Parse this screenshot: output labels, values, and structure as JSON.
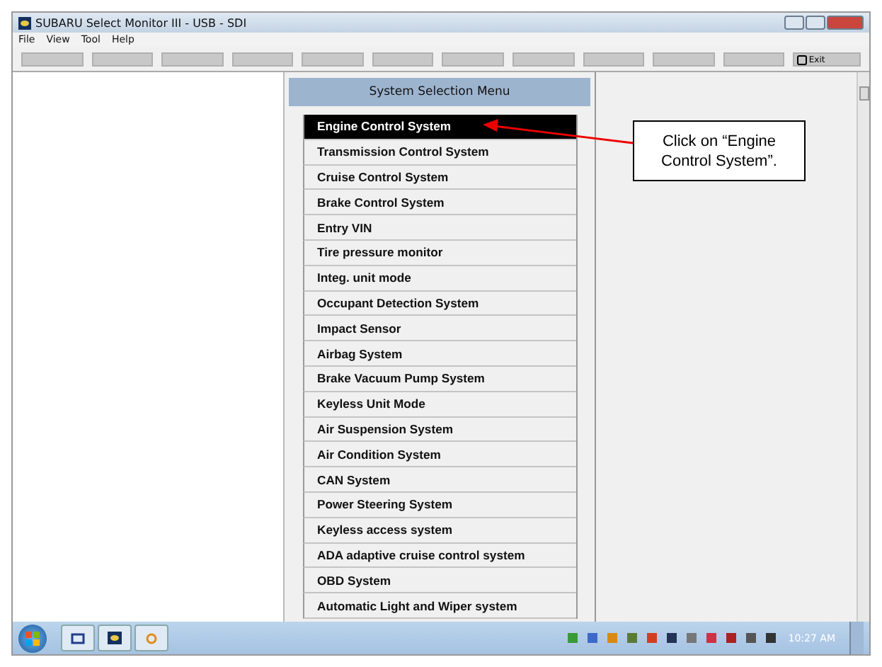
{
  "window": {
    "title": "SUBARU Select Monitor III - USB - SDI"
  },
  "menu": [
    "File",
    "View",
    "Tool",
    "Help"
  ],
  "toolbar": {
    "exit_label": "Exit"
  },
  "system_menu": {
    "title": "System Selection Menu",
    "items": [
      {
        "label": "Engine Control System",
        "selected": true
      },
      {
        "label": "Transmission Control System",
        "selected": false
      },
      {
        "label": "Cruise Control System",
        "selected": false
      },
      {
        "label": "Brake Control System",
        "selected": false
      },
      {
        "label": "Entry VIN",
        "selected": false
      },
      {
        "label": "Tire pressure monitor",
        "selected": false
      },
      {
        "label": "Integ. unit mode",
        "selected": false
      },
      {
        "label": "Occupant Detection System",
        "selected": false
      },
      {
        "label": "Impact Sensor",
        "selected": false
      },
      {
        "label": "Airbag System",
        "selected": false
      },
      {
        "label": "Brake Vacuum Pump System",
        "selected": false
      },
      {
        "label": "Keyless Unit Mode",
        "selected": false
      },
      {
        "label": "Air Suspension System",
        "selected": false
      },
      {
        "label": "Air Condition System",
        "selected": false
      },
      {
        "label": "CAN System",
        "selected": false
      },
      {
        "label": "Power Steering System",
        "selected": false
      },
      {
        "label": "Keyless access system",
        "selected": false
      },
      {
        "label": "ADA adaptive cruise control system",
        "selected": false
      },
      {
        "label": "OBD System",
        "selected": false
      },
      {
        "label": "Automatic Light and Wiper system",
        "selected": false
      }
    ]
  },
  "callout": {
    "text": "Click on “Engine Control System”."
  },
  "taskbar": {
    "clock": "10:27 AM"
  }
}
